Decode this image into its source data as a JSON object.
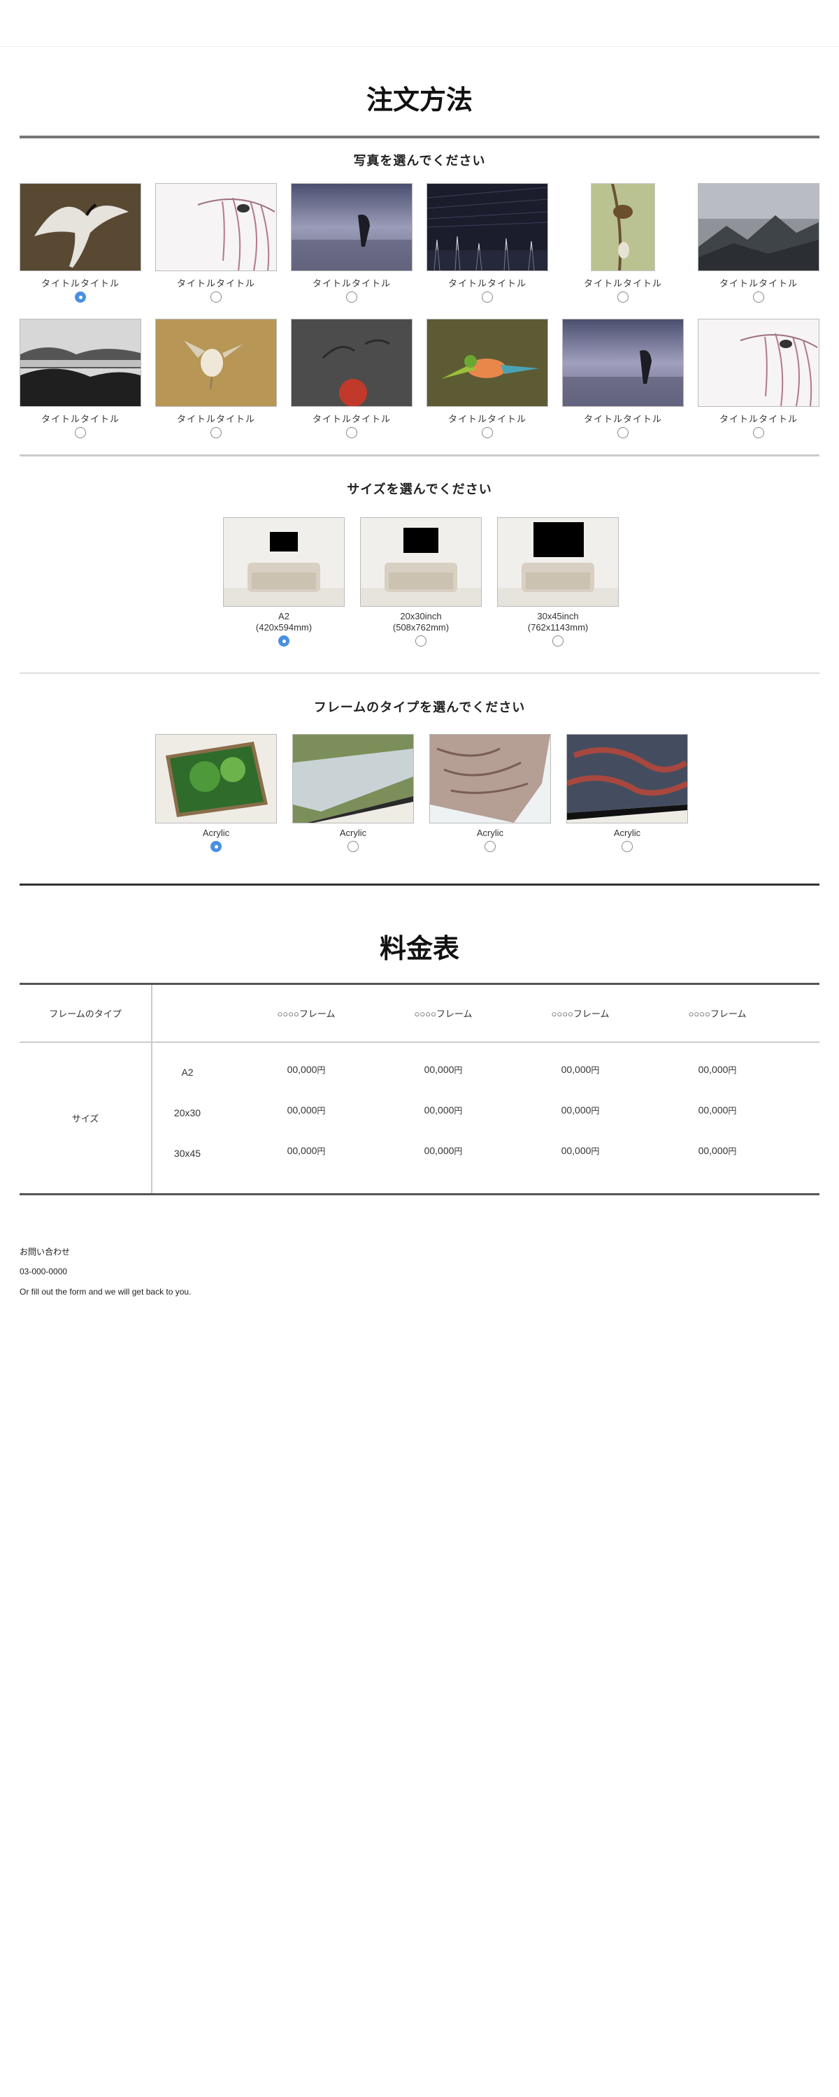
{
  "order": {
    "title": "注文方法",
    "photo_heading": "写真を選んでください",
    "photos": [
      {
        "caption": "タイトルタイトル",
        "selected": true,
        "image": "crane-in-flight"
      },
      {
        "caption": "タイトルタイトル",
        "selected": false,
        "image": "bird-on-blossom-branch"
      },
      {
        "caption": "タイトルタイトル",
        "selected": false,
        "image": "rock-in-lake-dusk"
      },
      {
        "caption": "タイトルタイトル",
        "selected": false,
        "image": "star-trails-night"
      },
      {
        "caption": "タイトルタイトル",
        "selected": false,
        "image": "bird-on-branch-portrait"
      },
      {
        "caption": "タイトルタイトル",
        "selected": false,
        "image": "misty-mountains"
      },
      {
        "caption": "タイトルタイトル",
        "selected": false,
        "image": "mist-forest-bw"
      },
      {
        "caption": "タイトルタイトル",
        "selected": false,
        "image": "small-bird-flying"
      },
      {
        "caption": "タイトルタイトル",
        "selected": false,
        "image": "cranes-and-sun"
      },
      {
        "caption": "タイトルタイトル",
        "selected": false,
        "image": "kingfisher-flight"
      },
      {
        "caption": "タイトルタイトル",
        "selected": false,
        "image": "rock-in-lake-dusk"
      },
      {
        "caption": "タイトルタイトル",
        "selected": false,
        "image": "bird-on-blossom-branch"
      }
    ],
    "size_heading": "サイズを選んでください",
    "sizes": [
      {
        "line1": "A2",
        "line2": "(420x594mm)",
        "selected": true
      },
      {
        "line1": "20x30inch",
        "line2": "(508x762mm)",
        "selected": false
      },
      {
        "line1": "30x45inch",
        "line2": "(762x1143mm)",
        "selected": false
      }
    ],
    "frame_heading": "フレームのタイプを選んでください",
    "frames": [
      {
        "label": "Acrylic",
        "selected": true,
        "image": "green-forest-print"
      },
      {
        "label": "Acrylic",
        "selected": false,
        "image": "river-landscape-print"
      },
      {
        "label": "Acrylic",
        "selected": false,
        "image": "rock-texture-print"
      },
      {
        "label": "Acrylic",
        "selected": false,
        "image": "aerial-red-print"
      }
    ]
  },
  "pricing": {
    "title": "料金表",
    "header_label": "フレームのタイプ",
    "frame_columns": [
      "○○○○フレーム",
      "○○○○フレーム",
      "○○○○フレーム",
      "○○○○フレーム"
    ],
    "size_label": "サイズ",
    "rows": [
      {
        "size": "A2",
        "prices": [
          "00,000",
          "00,000",
          "00,000",
          "00,000"
        ]
      },
      {
        "size": "20x30",
        "prices": [
          "00,000",
          "00,000",
          "00,000",
          "00,000"
        ]
      },
      {
        "size": "30x45",
        "prices": [
          "00,000",
          "00,000",
          "00,000",
          "00,000"
        ]
      }
    ],
    "currency": "円"
  },
  "contact": {
    "heading": "お問い合わせ",
    "phone": "03-000-0000",
    "note": "Or fill out the form and we will get back to you."
  }
}
